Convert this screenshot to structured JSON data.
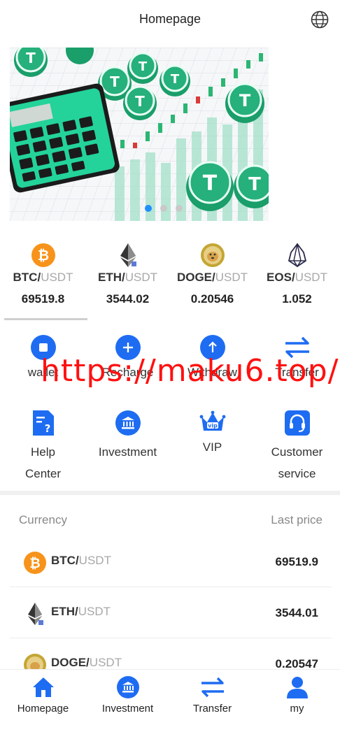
{
  "header": {
    "title": "Homepage",
    "language_icon": "globe-icon"
  },
  "banner": {
    "slides": 3,
    "active_slide": 1
  },
  "tickers": [
    {
      "base": "BTC/",
      "quote": "USDT",
      "price": "69519.8",
      "icon": "btc-icon"
    },
    {
      "base": "ETH/",
      "quote": "USDT",
      "price": "3544.02",
      "icon": "eth-icon"
    },
    {
      "base": "DOGE/",
      "quote": "USDT",
      "price": "0.20546",
      "icon": "doge-icon"
    },
    {
      "base": "EOS/",
      "quote": "USDT",
      "price": "1.052",
      "icon": "eos-icon"
    }
  ],
  "menu": {
    "wallet": "wallet",
    "recharge": "Recharge",
    "withdraw": "Withdraw",
    "transfer": "Transfer",
    "help_1": "Help",
    "help_2": "Center",
    "investment": "Investment",
    "vip": "VIP",
    "customer_1": "Customer",
    "customer_2": "service"
  },
  "watermark": "https://maku6.top/",
  "market": {
    "col_currency": "Currency",
    "col_price": "Last price",
    "rows": [
      {
        "base": "BTC/",
        "quote": "USDT",
        "price": "69519.9"
      },
      {
        "base": "ETH/",
        "quote": "USDT",
        "price": "3544.01"
      },
      {
        "base": "DOGE/",
        "quote": "USDT",
        "price": "0.20547"
      }
    ]
  },
  "tabbar": {
    "homepage": "Homepage",
    "investment": "Investment",
    "transfer": "Transfer",
    "my": "my"
  },
  "colors": {
    "accent": "#1e6cf2",
    "btc": "#f7931a",
    "doge": "#c3a634",
    "tether": "#26a17b",
    "watermark": "#ff1010"
  }
}
